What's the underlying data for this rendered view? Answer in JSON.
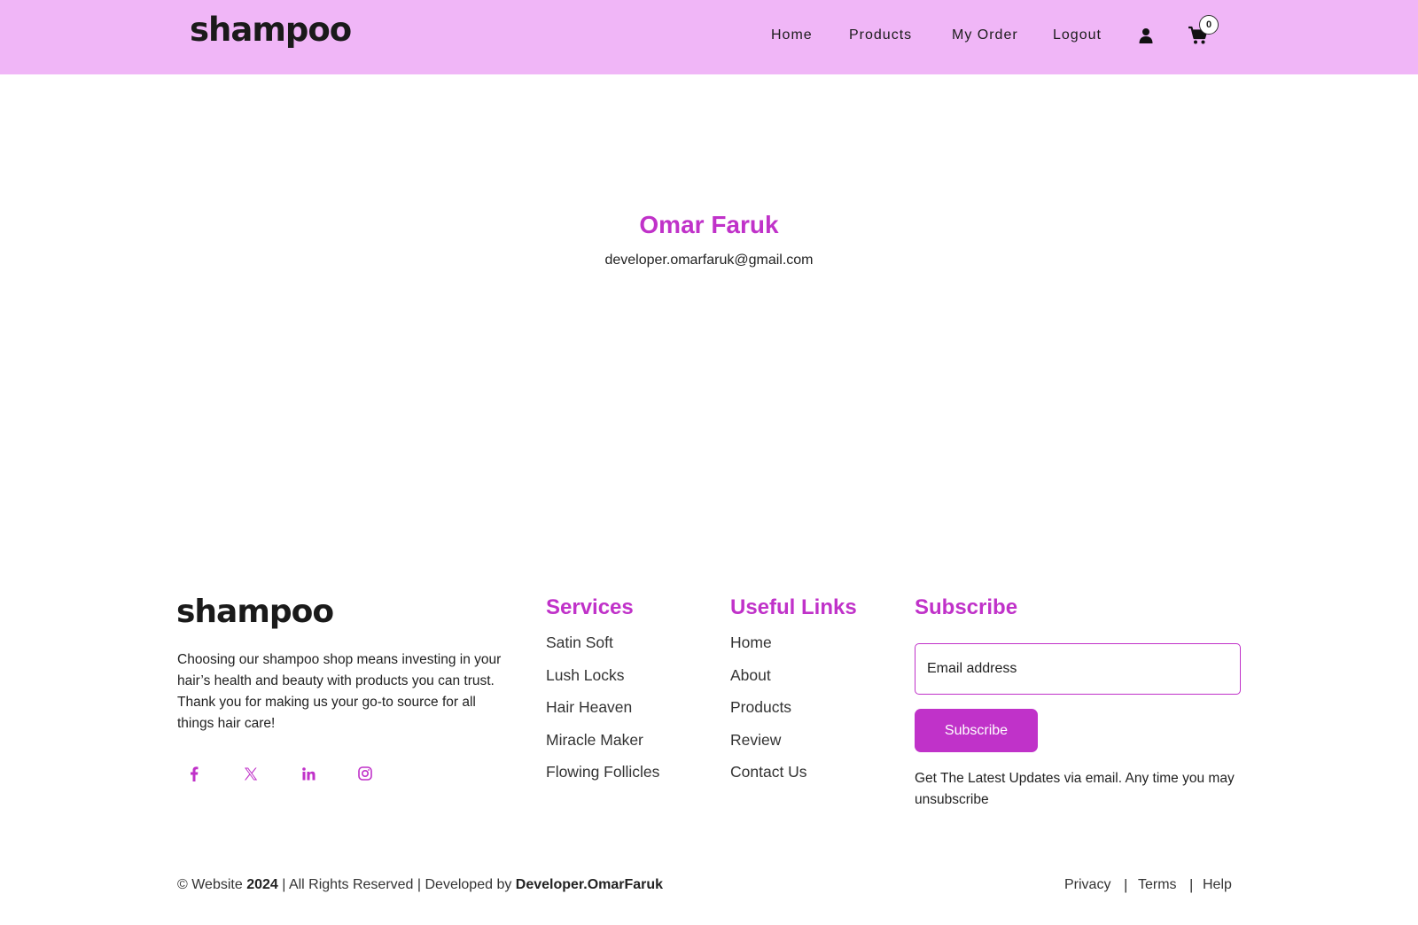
{
  "brand": {
    "logo_text": "shampoo"
  },
  "nav": {
    "home": "Home",
    "products": "Products",
    "my_order": "My Order",
    "logout": "Logout",
    "user_icon": "user-icon",
    "cart_icon": "cart-icon",
    "cart_count": "0"
  },
  "profile": {
    "name": "Omar Faruk",
    "email": "developer.omarfaruk@gmail.com"
  },
  "footer": {
    "logo_text": "shampoo",
    "about": "Choosing our shampoo shop means investing in your hair’s health and beauty with products you can trust. Thank you for making us your go-to source for all things hair care!",
    "social": [
      "facebook-icon",
      "x-icon",
      "linkedin-icon",
      "instagram-icon"
    ],
    "services": {
      "title": "Services",
      "items": [
        "Satin Soft",
        "Lush Locks",
        "Hair Heaven",
        "Miracle Maker",
        "Flowing Follicles"
      ]
    },
    "useful_links": {
      "title": "Useful Links",
      "items": [
        "Home",
        "About",
        "Products",
        "Review",
        "Contact Us"
      ]
    },
    "subscribe": {
      "title": "Subscribe",
      "email_placeholder": "Email address",
      "button_label": "Subscribe",
      "note": "Get The Latest Updates via email. Any time you may unsubscribe"
    },
    "copyright": {
      "prefix": "© Website ",
      "year": "2024",
      "middle": " | All Rights Reserved | Developed by ",
      "developer": "Developer.OmarFaruk"
    },
    "legal": {
      "privacy": "Privacy",
      "terms": "Terms",
      "help": "Help",
      "separator": "|"
    }
  },
  "colors": {
    "header_bg": "#f0b6f7",
    "accent": "#c032c9",
    "text": "#222222"
  }
}
